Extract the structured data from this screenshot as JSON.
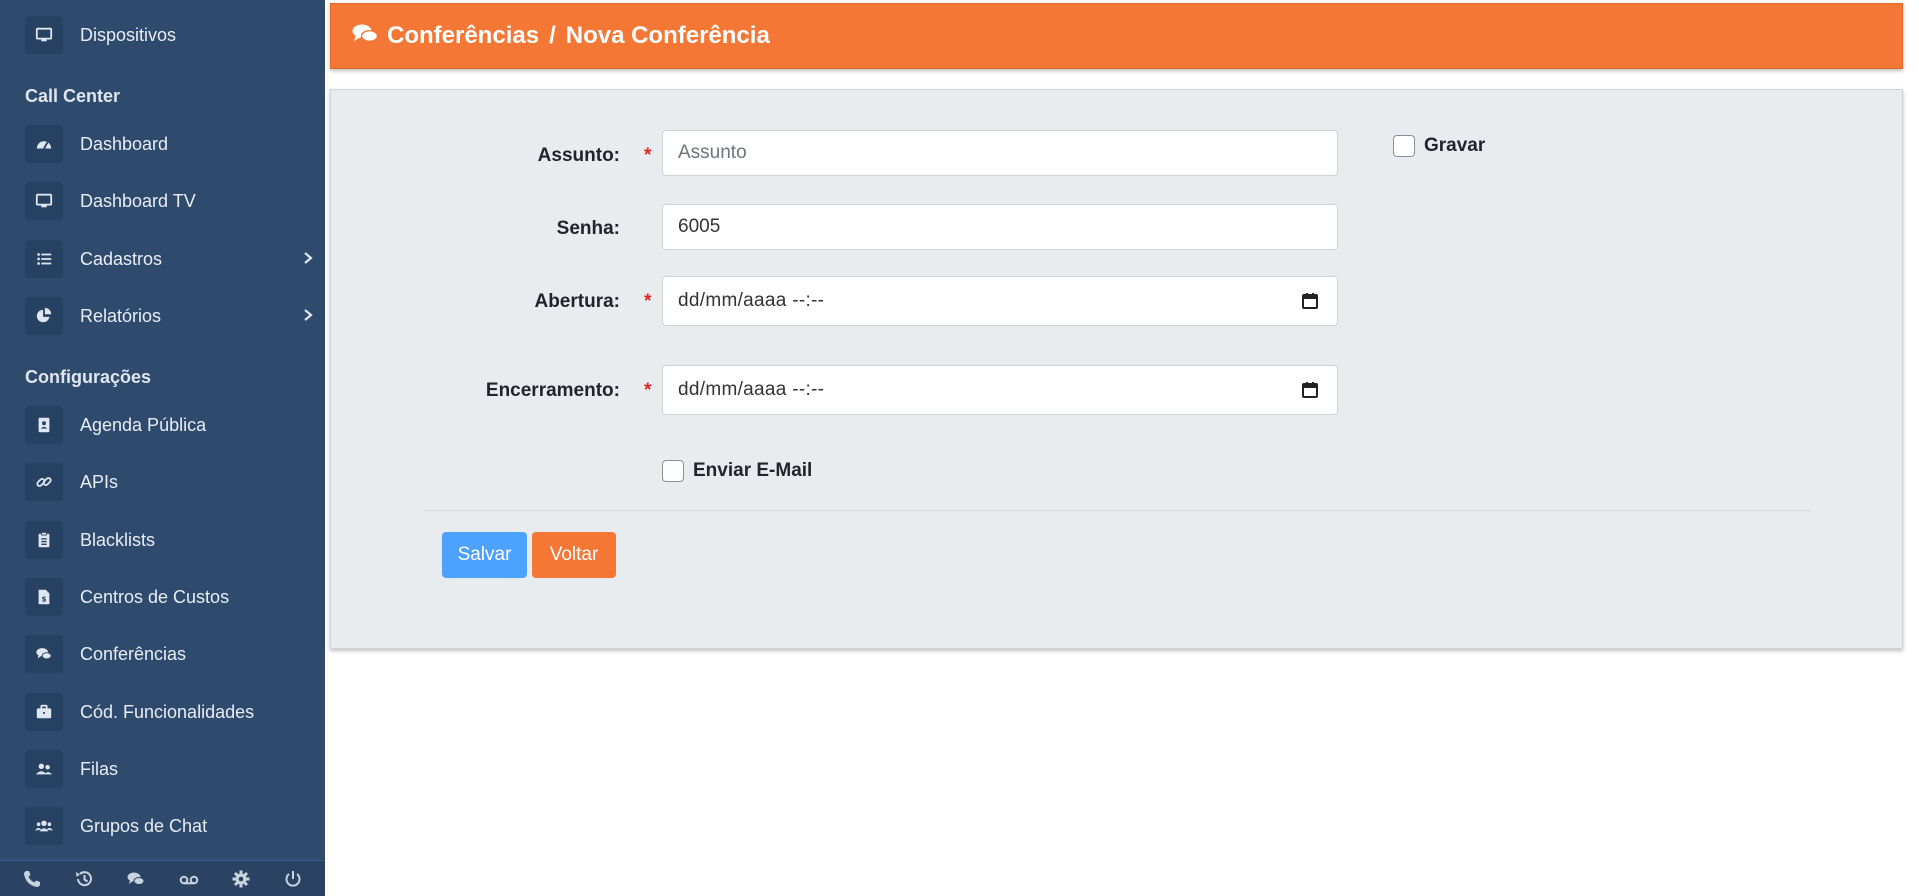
{
  "sidebar": {
    "items_top": [
      {
        "label": "Dispositivos",
        "icon": "monitor-icon"
      }
    ],
    "section_call_center": "Call Center",
    "call_center_items": [
      {
        "label": "Dashboard",
        "icon": "gauge-icon"
      },
      {
        "label": "Dashboard TV",
        "icon": "monitor-icon"
      },
      {
        "label": "Cadastros",
        "icon": "list-icon"
      },
      {
        "label": "Relatórios",
        "icon": "pie-chart-icon"
      }
    ],
    "section_config": "Configurações",
    "config_items": [
      {
        "label": "Agenda Pública",
        "icon": "address-book-icon"
      },
      {
        "label": "APIs",
        "icon": "link-icon"
      },
      {
        "label": "Blacklists",
        "icon": "clipboard-icon"
      },
      {
        "label": "Centros de Custos",
        "icon": "invoice-icon"
      },
      {
        "label": "Conferências",
        "icon": "comments-icon"
      },
      {
        "label": "Cód. Funcionalidades",
        "icon": "briefcase-icon"
      },
      {
        "label": "Filas",
        "icon": "users-icon"
      },
      {
        "label": "Grupos de Chat",
        "icon": "user-group-icon"
      }
    ],
    "bottom_icons": [
      "phone-icon",
      "history-icon",
      "chat-icon",
      "voicemail-icon",
      "gear-icon",
      "power-icon"
    ]
  },
  "header": {
    "icon": "comments-icon",
    "section": "Conferências",
    "separator": "/",
    "page": "Nova Conferência"
  },
  "form": {
    "subject_label": "Assunto:",
    "subject_placeholder": "Assunto",
    "subject_value": "",
    "password_label": "Senha:",
    "password_value": "6005",
    "opening_label": "Abertura:",
    "opening_value": "dd/mm/aaaa --:--",
    "closing_label": "Encerramento:",
    "closing_value": "dd/mm/aaaa --:--",
    "required_mark": "*",
    "send_email_label": "Enviar E-Mail",
    "send_email_checked": false,
    "record_label": "Gravar",
    "record_checked": false,
    "save_label": "Salvar",
    "back_label": "Voltar"
  },
  "colors": {
    "sidebar_bg": "#2e4a6d",
    "header_orange": "#f47735",
    "save_blue": "#4da1ff",
    "required_red": "#e02424"
  }
}
